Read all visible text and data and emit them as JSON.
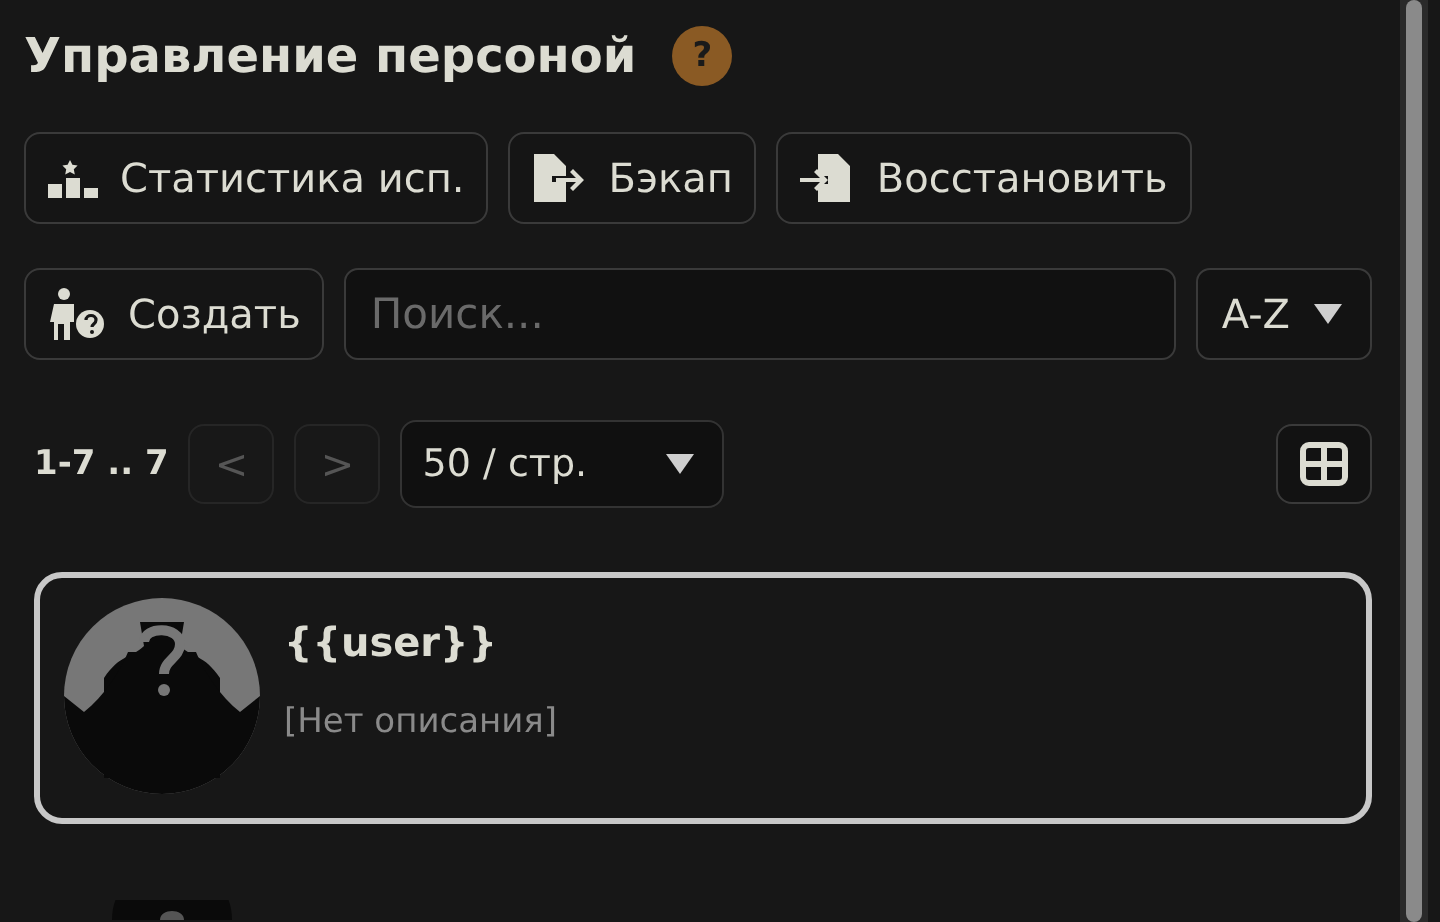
{
  "title": "Управление персоной",
  "help": "?",
  "actions": [
    {
      "kind": "stats",
      "label": "Статистика исп."
    },
    {
      "kind": "backup",
      "label": "Бэкап"
    },
    {
      "kind": "restore",
      "label": "Восстановить"
    }
  ],
  "create": {
    "label": "Создать"
  },
  "search": {
    "placeholder": "Поиск..."
  },
  "sort": {
    "value": "A-Z"
  },
  "pagination": {
    "range": "1-7 .. 7",
    "prev": {
      "label": "<",
      "disabled": true
    },
    "next": {
      "label": ">",
      "disabled": true
    },
    "page_size": "50 / стр."
  },
  "personas": [
    {
      "name": "{{user}}",
      "description": "[Нет описания]",
      "selected": true
    }
  ]
}
